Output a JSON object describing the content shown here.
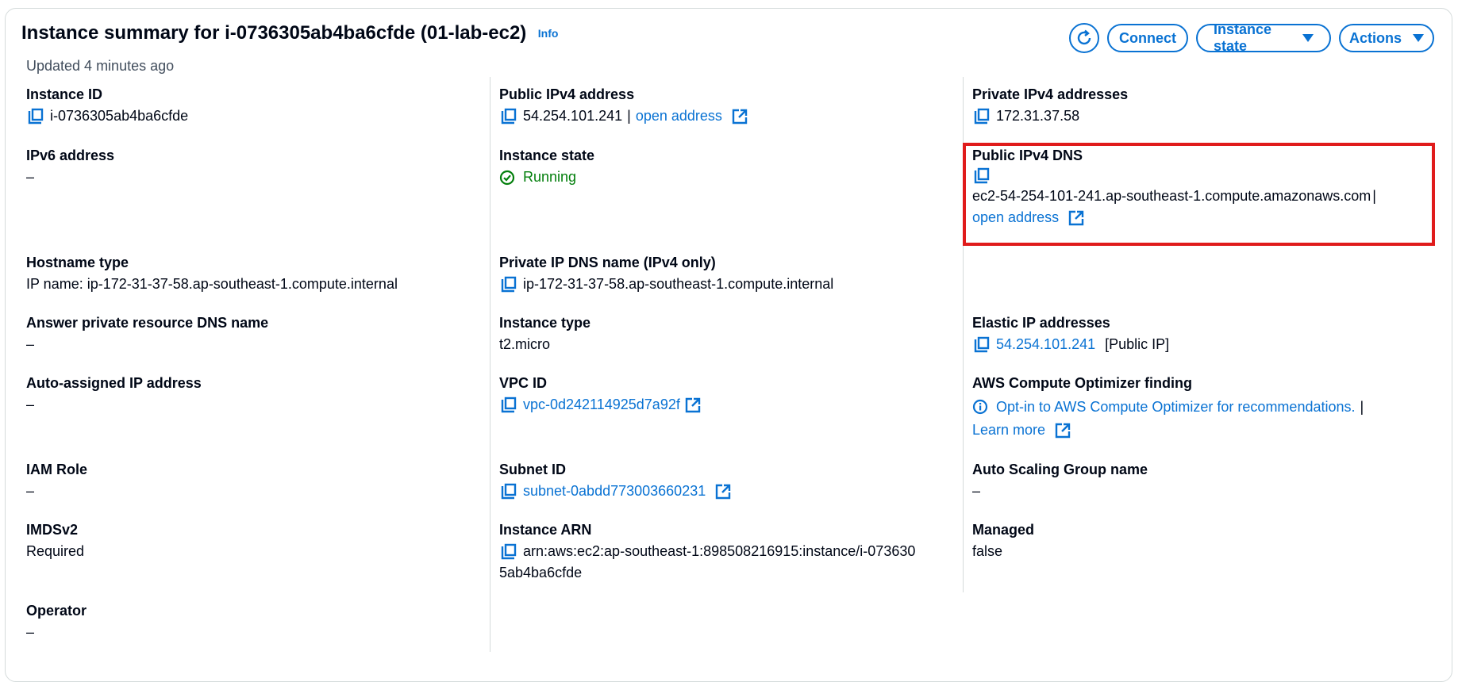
{
  "header": {
    "title": "Instance summary for i-0736305ab4ba6cfde (01-lab-ec2)",
    "info": "Info",
    "updated": "Updated 4 minutes ago",
    "buttons": {
      "connect": "Connect",
      "instance_state": "Instance state",
      "actions": "Actions"
    }
  },
  "col1": {
    "instance_id": {
      "label": "Instance ID",
      "value": "i-0736305ab4ba6cfde"
    },
    "ipv6": {
      "label": "IPv6 address",
      "value": "–"
    },
    "hostname_type": {
      "label": "Hostname type",
      "value": "IP name: ip-172-31-37-58.ap-southeast-1.compute.internal"
    },
    "answer_dns": {
      "label": "Answer private resource DNS name",
      "value": "–"
    },
    "auto_ip": {
      "label": "Auto-assigned IP address",
      "value": "–"
    },
    "iam_role": {
      "label": "IAM Role",
      "value": "–"
    },
    "imdsv2": {
      "label": "IMDSv2",
      "value": "Required"
    },
    "operator": {
      "label": "Operator",
      "value": "–"
    }
  },
  "col2": {
    "public_ipv4": {
      "label": "Public IPv4 address",
      "value": "54.254.101.241",
      "sep": "|",
      "link": "open address"
    },
    "instance_state": {
      "label": "Instance state",
      "value": "Running"
    },
    "private_dns": {
      "label": "Private IP DNS name (IPv4 only)",
      "value": "ip-172-31-37-58.ap-southeast-1.compute.internal"
    },
    "instance_type": {
      "label": "Instance type",
      "value": "t2.micro"
    },
    "vpc_id": {
      "label": "VPC ID",
      "value": "vpc-0d242114925d7a92f"
    },
    "subnet_id": {
      "label": "Subnet ID",
      "value": "subnet-0abdd773003660231"
    },
    "arn": {
      "label": "Instance ARN",
      "line1": "arn:aws:ec2:ap-southeast-1:898508216915:instance/i-073630",
      "line2": "5ab4ba6cfde"
    }
  },
  "col3": {
    "private_ipv4": {
      "label": "Private IPv4 addresses",
      "value": "172.31.37.58"
    },
    "public_dns": {
      "label": "Public IPv4 DNS",
      "value": "ec2-54-254-101-241.ap-southeast-1.compute.amazonaws.com",
      "sep": "|",
      "link": "open address"
    },
    "elastic_ip": {
      "label": "Elastic IP addresses",
      "value": "54.254.101.241",
      "suffix": "[Public IP]"
    },
    "optimizer": {
      "label": "AWS Compute Optimizer finding",
      "link": "Opt-in to AWS Compute Optimizer for recommendations.",
      "sep": "|",
      "learn": "Learn more"
    },
    "asg": {
      "label": "Auto Scaling Group name",
      "value": "–"
    },
    "managed": {
      "label": "Managed",
      "value": "false"
    }
  },
  "colors": {
    "link": "#0972d3",
    "success": "#037f0c",
    "highlight": "#e01b1b"
  },
  "icons": [
    "refresh-icon",
    "caret-down-icon",
    "copy-icon",
    "external-link-icon",
    "status-success-icon",
    "info-circle-icon"
  ]
}
